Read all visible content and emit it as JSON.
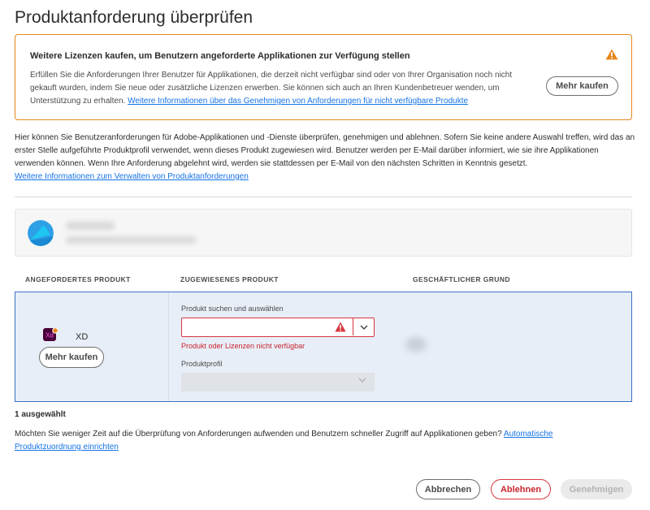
{
  "dialog": {
    "title": "Produktanforderung überprüfen"
  },
  "alert": {
    "title": "Weitere Lizenzen kaufen, um Benutzern angeforderte Applikationen zur Verfügung stellen",
    "body": "Erfüllen Sie die Anforderungen Ihrer Benutzer für Applikationen, die derzeit nicht verfügbar sind oder von Ihrer Organisation noch nicht gekauft wurden, indem Sie neue oder zusätzliche Lizenzen erwerben. Sie können sich auch an Ihren Kundenbetreuer wenden, um Unterstützung zu erhalten.",
    "link": "Weitere Informationen über das Genehmigen von Anforderungen für nicht verfügbare Produkte",
    "buy_label": "Mehr kaufen",
    "icon": "warning-icon",
    "color": "#e68619"
  },
  "intro": {
    "text": "Hier können Sie Benutzeranforderungen für Adobe-Applikationen und -Dienste überprüfen, genehmigen und ablehnen. Sofern Sie keine andere Auswahl treffen, wird das an erster Stelle aufgeführte Produktprofil verwendet, wenn dieses Produkt zugewiesen wird. Benutzer werden per E-Mail darüber informiert, wie sie ihre Applikationen verwenden können. Wenn Ihre Anforderung abgelehnt wird, werden sie stattdessen per E-Mail von den nächsten Schritten in Kenntnis gesetzt.",
    "link": "Weitere Informationen zum Verwalten von Produktanforderungen"
  },
  "table": {
    "headers": [
      "ANGEFORDERTES PRODUKT",
      "ZUGEWIESENES PRODUKT",
      "GESCHÄFTLICHER GRUND"
    ],
    "row": {
      "product_badge": "Xd",
      "product_name": "XD",
      "buy_label": "Mehr kaufen",
      "search_label": "Produkt suchen und auswählen",
      "search_value": "",
      "error": "Produkt oder Lizenzen nicht verfügbar",
      "profile_label": "Produktprofil",
      "profile_value": ""
    }
  },
  "footer": {
    "selected_count": "1 ausgewählt",
    "auto_text": "Möchten Sie weniger Zeit auf die Überprüfung von Anforderungen aufwenden und Benutzern schneller Zugriff auf Applikationen geben?",
    "auto_link": "Automatische Produktzuordnung einrichten",
    "cancel": "Abbrechen",
    "reject": "Ablehnen",
    "approve": "Genehmigen"
  },
  "colors": {
    "accent": "#1473e6",
    "error": "#d7373f",
    "selection_border": "#3a72c4",
    "selection_bg": "#e8eef7"
  }
}
